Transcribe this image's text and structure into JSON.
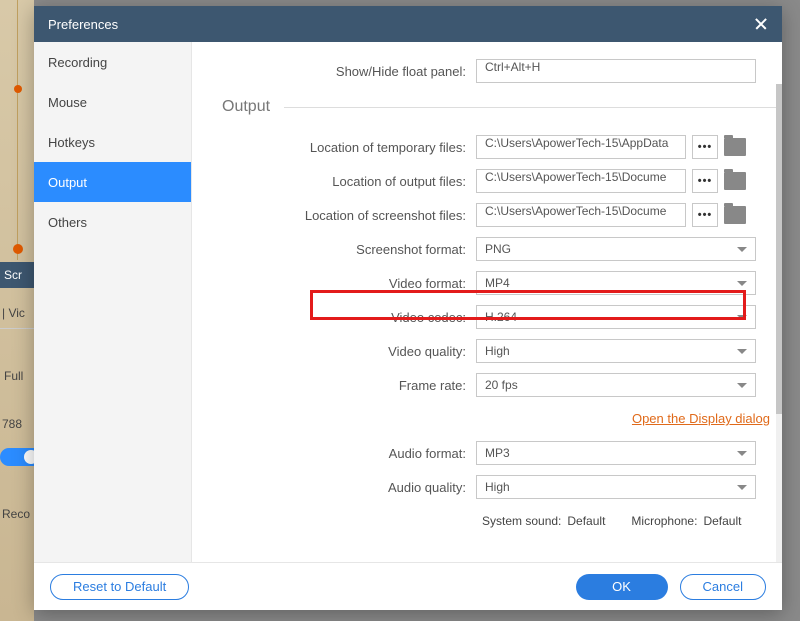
{
  "bg": {
    "scr": "Scr",
    "vid": "| Vic",
    "full": "Full",
    "num": "788",
    "reco": "Reco"
  },
  "dialog": {
    "title": "Preferences",
    "sidebar": {
      "items": [
        {
          "label": "Recording"
        },
        {
          "label": "Mouse"
        },
        {
          "label": "Hotkeys"
        },
        {
          "label": "Output"
        },
        {
          "label": "Others"
        }
      ]
    },
    "rows": {
      "float_panel": {
        "label": "Show/Hide float panel:",
        "value": "Ctrl+Alt+H"
      },
      "section": "Output",
      "temp_loc": {
        "label": "Location of temporary files:",
        "value": "C:\\Users\\ApowerTech-15\\AppData"
      },
      "out_loc": {
        "label": "Location of output files:",
        "value": "C:\\Users\\ApowerTech-15\\Docume"
      },
      "shot_loc": {
        "label": "Location of screenshot files:",
        "value": "C:\\Users\\ApowerTech-15\\Docume"
      },
      "shot_fmt": {
        "label": "Screenshot format:",
        "value": "PNG"
      },
      "vid_fmt": {
        "label": "Video format:",
        "value": "MP4"
      },
      "vid_codec": {
        "label": "Video codec:",
        "value": "H.264"
      },
      "vid_quality": {
        "label": "Video quality:",
        "value": "High"
      },
      "frame_rate": {
        "label": "Frame rate:",
        "value": "20 fps"
      },
      "aud_fmt": {
        "label": "Audio format:",
        "value": "MP3"
      },
      "aud_quality": {
        "label": "Audio quality:",
        "value": "High"
      },
      "display_link": "Open the Display dialog",
      "sys_sound": {
        "label": "System sound:",
        "value": "Default"
      },
      "mic": {
        "label": "Microphone:",
        "value": "Default"
      }
    },
    "footer": {
      "reset": "Reset to Default",
      "ok": "OK",
      "cancel": "Cancel"
    }
  }
}
